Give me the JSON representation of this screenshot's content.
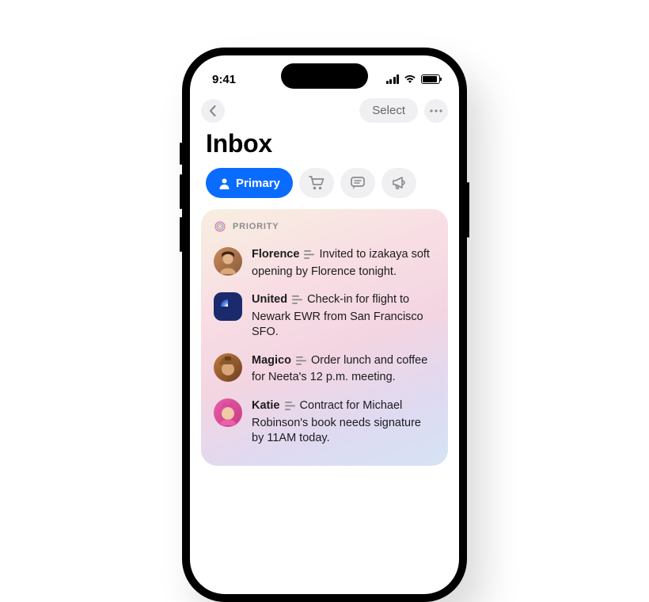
{
  "status_bar": {
    "time": "9:41"
  },
  "nav": {
    "select_label": "Select"
  },
  "page_title": "Inbox",
  "tabs": {
    "primary_label": "Primary"
  },
  "priority": {
    "label": "PRIORITY",
    "messages": [
      {
        "sender": "Florence",
        "summary": "Invited to izakaya soft opening by Florence tonight."
      },
      {
        "sender": "United",
        "summary": "Check-in for flight to Newark EWR from San Francisco SFO."
      },
      {
        "sender": "Magico",
        "summary": "Order lunch and coffee for Neeta's 12 p.m. meeting."
      },
      {
        "sender": "Katie",
        "summary": "Contract for Michael Robinson's book needs signature by 11AM today."
      }
    ]
  }
}
